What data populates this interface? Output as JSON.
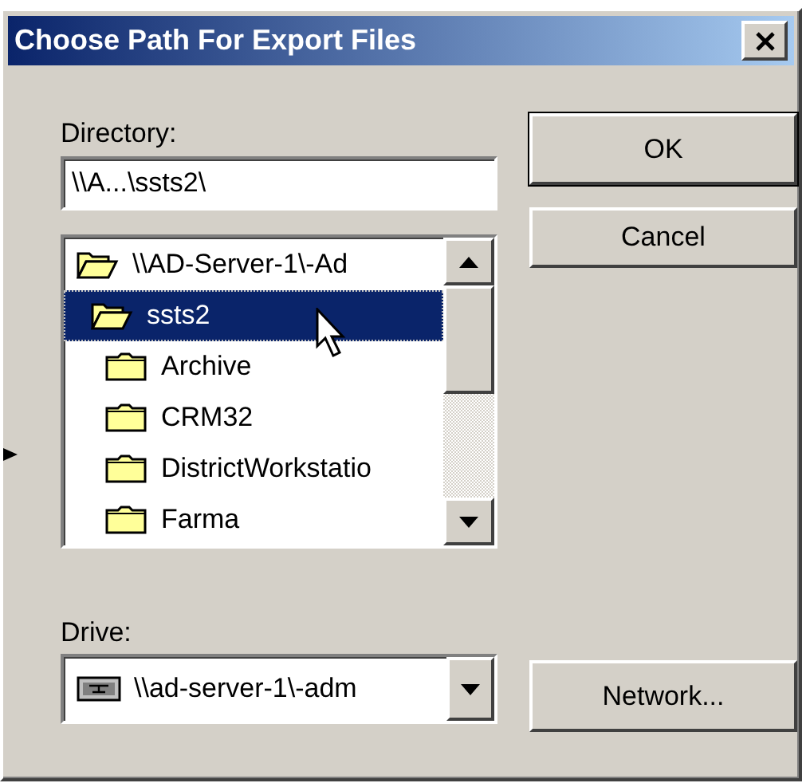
{
  "window": {
    "title": "Choose Path For Export Files"
  },
  "directory": {
    "label": "Directory:",
    "value": "\\\\A...\\ssts2\\"
  },
  "folders": [
    {
      "name": "\\\\AD-Server-1\\-Ad",
      "expanded": true,
      "selected": false,
      "children": [
        {
          "name": "ssts2",
          "expanded": true,
          "selected": true,
          "children": [
            {
              "name": "Archive",
              "expanded": false,
              "selected": false
            },
            {
              "name": "CRM32",
              "expanded": false,
              "selected": false
            },
            {
              "name": "DistrictWorkstatio",
              "expanded": false,
              "selected": false
            },
            {
              "name": "Farma",
              "expanded": false,
              "selected": false
            }
          ]
        }
      ]
    }
  ],
  "drive": {
    "label": "Drive:",
    "value": "\\\\ad-server-1\\-adm"
  },
  "buttons": [
    {
      "label": "OK",
      "kind": "default"
    },
    {
      "label": "Cancel",
      "kind": "normal"
    },
    {
      "label": "Network...",
      "kind": "normal"
    }
  ]
}
